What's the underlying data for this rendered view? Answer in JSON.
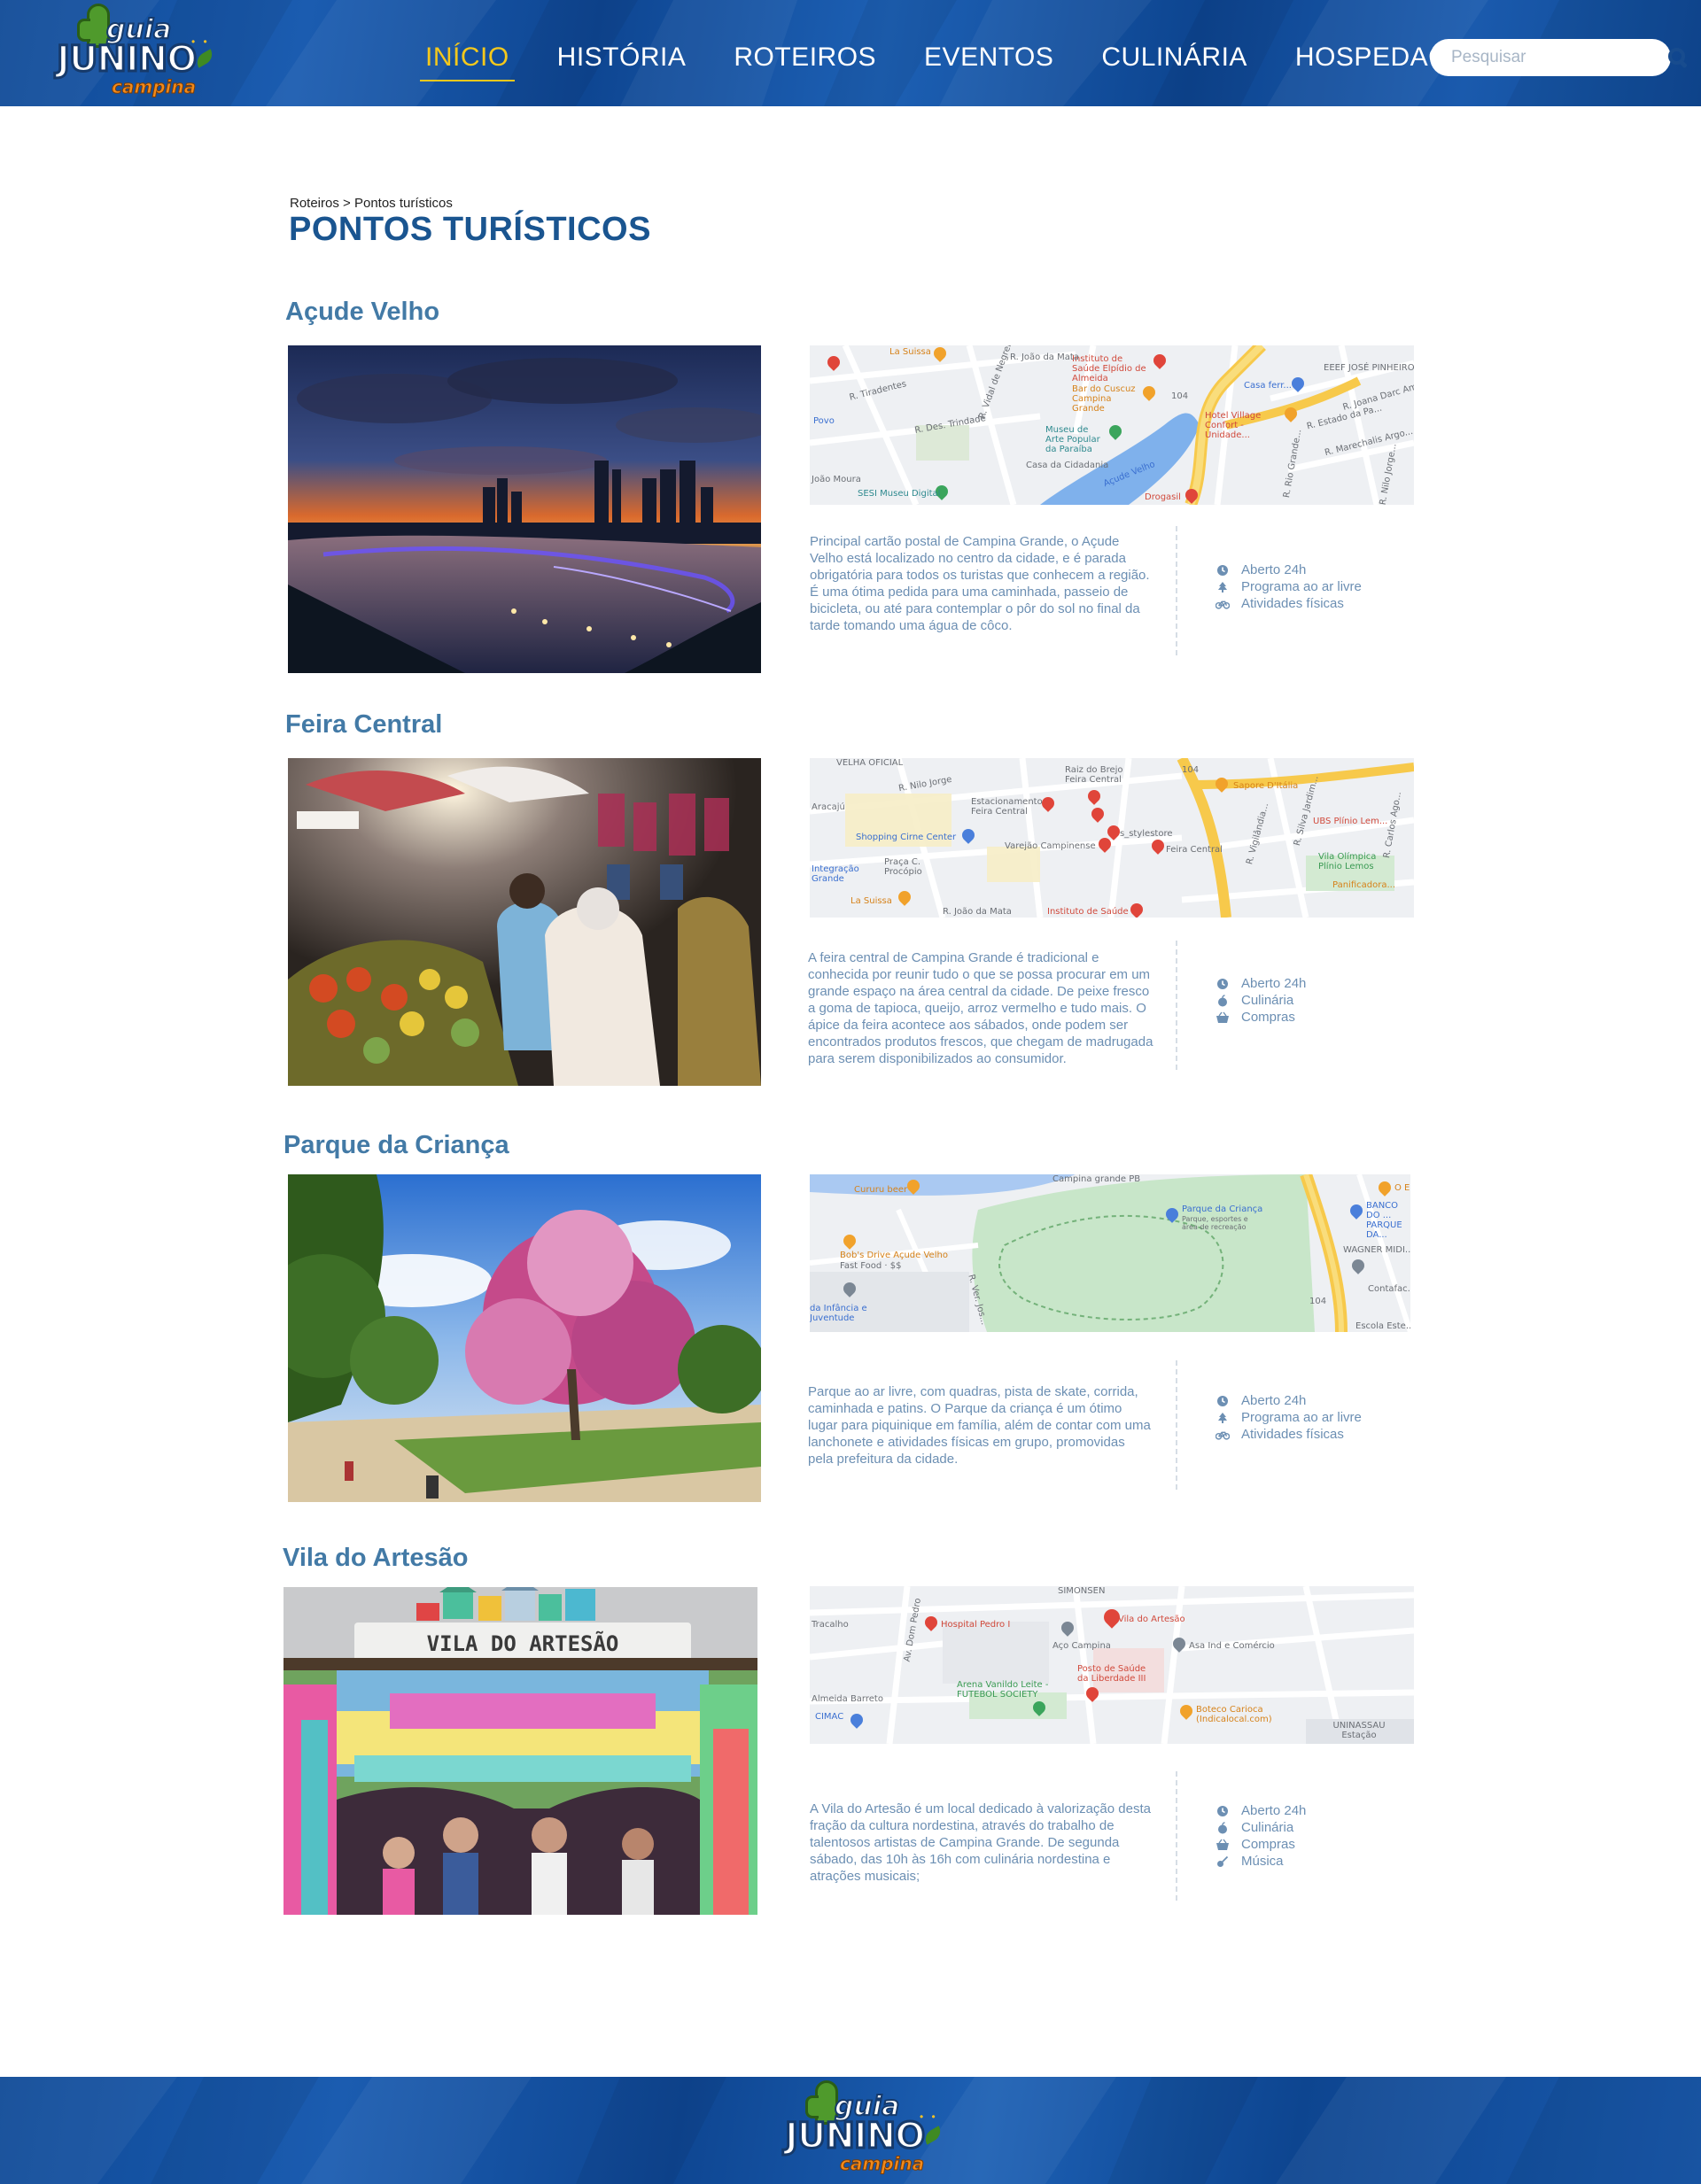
{
  "header": {
    "logo": {
      "line1": "guia",
      "line2": "JUNINO",
      "line3": "campina",
      "alt": "Guia Junino Campina"
    },
    "nav": [
      {
        "label": "INÍCIO",
        "active": true
      },
      {
        "label": "HISTÓRIA",
        "active": false
      },
      {
        "label": "ROTEIROS",
        "active": false
      },
      {
        "label": "EVENTOS",
        "active": false
      },
      {
        "label": "CULINÁRIA",
        "active": false
      },
      {
        "label": "HOSPEDAGEM",
        "active": false
      }
    ],
    "search": {
      "placeholder": "Pesquisar",
      "value": ""
    }
  },
  "breadcrumb": {
    "parent": "Roteiros",
    "separator": " > ",
    "current": "Pontos turísticos"
  },
  "page_title": "PONTOS TURÍSTICOS",
  "places": [
    {
      "title": "Açude Velho",
      "description": "Principal cartão postal de Campina Grande, o Açude Velho está localizado no centro da cidade, e é parada obrigatória para todos os turistas que conhecem a região. É uma ótima pedida para uma caminhada, passeio de bicicleta, ou até para contemplar o pôr do sol no final da tarde tomando uma água de côco.",
      "features": [
        {
          "icon": "clock-icon",
          "label": "Aberto 24h"
        },
        {
          "icon": "tree-icon",
          "label": "Programa ao ar livre"
        },
        {
          "icon": "bicycle-icon",
          "label": "Atividades físicas"
        }
      ],
      "map_labels": {
        "l1": "La Suissa",
        "l2": "Instituto de Saúde Elpídio de Almeida",
        "l3": "Bar do Cuscuz Campina Grande",
        "l4": "Museu de Arte Popular da Paraíba",
        "l5": "Hotel Village Confort - Unidade...",
        "l6": "Açude Velho",
        "l7": "SESI Museu Digital",
        "l8": "Casa ferr...",
        "l9": "EEEF JOSÉ PINHEIRO",
        "l10": "R. João da Mata",
        "l11": "R. Tiradentes",
        "l12": "R. Des. Trindade",
        "l13": "Povo",
        "l14": "Casa da Cidadania",
        "l15": "104",
        "l16": "Drogasil",
        "l17": "João Moura",
        "l18": "R. Vidal de Negreiros",
        "l19": "R. Joana Darc Amorim",
        "l20": "R. Estado da Pa...",
        "l21": "R. Marechalis Argo...",
        "l22": "R. Rio Grande...",
        "l23": "R. Nilo Jorge..."
      }
    },
    {
      "title": "Feira Central",
      "description": "A feira central de Campina Grande é tradicional e conhecida por reunir tudo o que se possa procurar em um grande espaço na área central da cidade. De peixe fresco a goma de tapioca, queijo, arroz vermelho e tudo mais. O ápice da feira acontece aos sábados, onde podem ser encontrados produtos frescos, que chegam de madrugada para serem disponibilizados ao consumidor.",
      "features": [
        {
          "icon": "clock-icon",
          "label": "Aberto 24h"
        },
        {
          "icon": "food-icon",
          "label": "Culinária"
        },
        {
          "icon": "basket-icon",
          "label": "Compras"
        }
      ],
      "map_labels": {
        "l1": "Raiz do Brejo Feira Central",
        "l2": "Estacionamento Feira Central",
        "l3": "Shopping Cirne Center",
        "l4": "Varejão Campinense",
        "l5": "Feira Central",
        "l6": "s_stylestore",
        "l7": "Sapore D'Itália",
        "l8": "UBS Plínio Lem...",
        "l9": "Vila Olímpica Plínio Lemos",
        "l10": "Panificadora...",
        "l11": "La Suissa",
        "l12": "Instituto de Saúde",
        "l13": "Praça C. Procópio",
        "l14": "Integração Grande",
        "l15": "VELHA OFICIAL",
        "l16": "104",
        "l17": "Aracajú",
        "l18": "R. João da Mata",
        "l19": "R. Nilo Jorge",
        "l20": "R. Carlos Ago...",
        "l21": "R. Vigilândia...",
        "l22": "R. Silva Jardim..."
      }
    },
    {
      "title": "Parque da Criança",
      "description": "Parque ao ar livre, com quadras, pista de skate, corrida, caminhada e patins. O Parque da criança é um ótimo lugar para piquinique em família, além de contar com uma lanchonete e atividades físicas em grupo, promovidas pela prefeitura da cidade.",
      "features": [
        {
          "icon": "clock-icon",
          "label": "Aberto 24h"
        },
        {
          "icon": "tree-icon",
          "label": "Programa ao ar livre"
        },
        {
          "icon": "bicycle-icon",
          "label": "Atividades físicas"
        }
      ],
      "map_labels": {
        "l1": "Cururu beer",
        "l2": "Campina grande PB",
        "l3": "Parque da Criança",
        "l4": "Parque, esportes e área de recreação",
        "l5": "Bob's Drive Açude Velho",
        "l6": "Fast Food · $$",
        "l7": "da Infância e Juventude",
        "l8": "WAGNER MIDI...",
        "l9": "BANCO DO ... PARQUE DA...",
        "l10": "Contafac...",
        "l11": "104",
        "l12": "O E...",
        "l13": "R. Ver. Jos...",
        "l14": "Escola Este..."
      }
    },
    {
      "title": "Vila do Artesão",
      "description": "A Vila do Artesão é um local dedicado à valorização desta fração da cultura nordestina, através do trabalho de talentosos artistas de Campina Grande. De segunda sábado, das 10h às 16h com culinária nordestina e atrações musicais;",
      "features": [
        {
          "icon": "clock-icon",
          "label": "Aberto 24h"
        },
        {
          "icon": "food-icon",
          "label": "Culinária"
        },
        {
          "icon": "basket-icon",
          "label": "Compras"
        },
        {
          "icon": "guitar-icon",
          "label": "Música"
        }
      ],
      "photo_sign": "VILA DO ARTESÃO",
      "map_labels": {
        "l1": "Vila do Artesão",
        "l2": "Hospital Pedro I",
        "l3": "Aço Campina",
        "l4": "Asa Ind e Comércio",
        "l5": "Posto de Saúde da Liberdade III",
        "l6": "Arena Vanildo Leite - FUTEBOL SOCIETY",
        "l7": "Boteco Carioca (Indicalocal.com)",
        "l8": "UNINASSAU Estação",
        "l9": "SIMONSEN",
        "l10": "Almeida Barreto",
        "l11": "Av. Dom Pedro",
        "l12": "CIMAC",
        "l13": "Tracalho"
      }
    }
  ],
  "footer": {
    "logo": {
      "line1": "guia",
      "line2": "JUNINO",
      "line3": "campina",
      "alt": "Guia Junino Campina"
    }
  },
  "colors": {
    "header_blue": "#0f4a97",
    "nav_active": "#f4c81c",
    "title_blue": "#1a5590",
    "place_title": "#437aa6",
    "text_blue": "#6c8fb3",
    "logo_orange": "#f28a1b",
    "cactus_green": "#4f9a2c"
  }
}
